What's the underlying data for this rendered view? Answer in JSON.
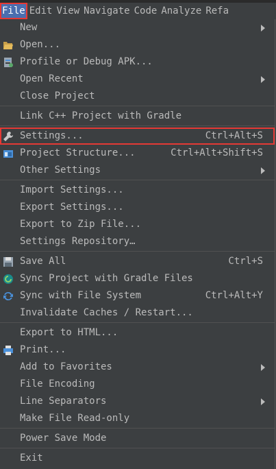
{
  "menubar": {
    "items": [
      "File",
      "Edit",
      "View",
      "Navigate",
      "Code",
      "Analyze",
      "Refa"
    ],
    "active": "File"
  },
  "menu": {
    "items": {
      "new": {
        "label": "New"
      },
      "open": {
        "label": "Open..."
      },
      "profile": {
        "label": "Profile or Debug APK..."
      },
      "open_recent": {
        "label": "Open Recent"
      },
      "close_project": {
        "label": "Close Project"
      },
      "link_cpp": {
        "label": "Link C++ Project with Gradle"
      },
      "settings": {
        "label": "Settings...",
        "shortcut": "Ctrl+Alt+S"
      },
      "project_structure": {
        "label": "Project Structure...",
        "shortcut": "Ctrl+Alt+Shift+S"
      },
      "other_settings": {
        "label": "Other Settings"
      },
      "import_settings": {
        "label": "Import Settings..."
      },
      "export_settings": {
        "label": "Export Settings..."
      },
      "export_zip": {
        "label": "Export to Zip File..."
      },
      "settings_repo": {
        "label": "Settings Repository…"
      },
      "save_all": {
        "label": "Save All",
        "shortcut": "Ctrl+S"
      },
      "sync_gradle": {
        "label": "Sync Project with Gradle Files"
      },
      "sync_fs": {
        "label": "Sync with File System",
        "shortcut": "Ctrl+Alt+Y"
      },
      "invalidate": {
        "label": "Invalidate Caches / Restart..."
      },
      "export_html": {
        "label": "Export to HTML..."
      },
      "print": {
        "label": "Print..."
      },
      "favorites": {
        "label": "Add to Favorites"
      },
      "file_encoding": {
        "label": "File Encoding"
      },
      "line_separators": {
        "label": "Line Separators"
      },
      "read_only": {
        "label": "Make File Read-only"
      },
      "power_save": {
        "label": "Power Save Mode"
      },
      "exit": {
        "label": "Exit"
      }
    }
  },
  "colors": {
    "background": "#3c3f41",
    "text": "#bbbbbb",
    "separator": "#515151",
    "highlight_border": "#e53935",
    "active_menu": "#4b6eaf"
  },
  "icons": {
    "open": "folder-open-icon",
    "profile": "apk-profile-icon",
    "settings": "wrench-icon",
    "project_structure": "project-structure-icon",
    "save_all": "floppy-disk-icon",
    "sync_gradle": "gradle-sync-icon",
    "sync_fs": "refresh-icon",
    "print": "printer-icon"
  }
}
